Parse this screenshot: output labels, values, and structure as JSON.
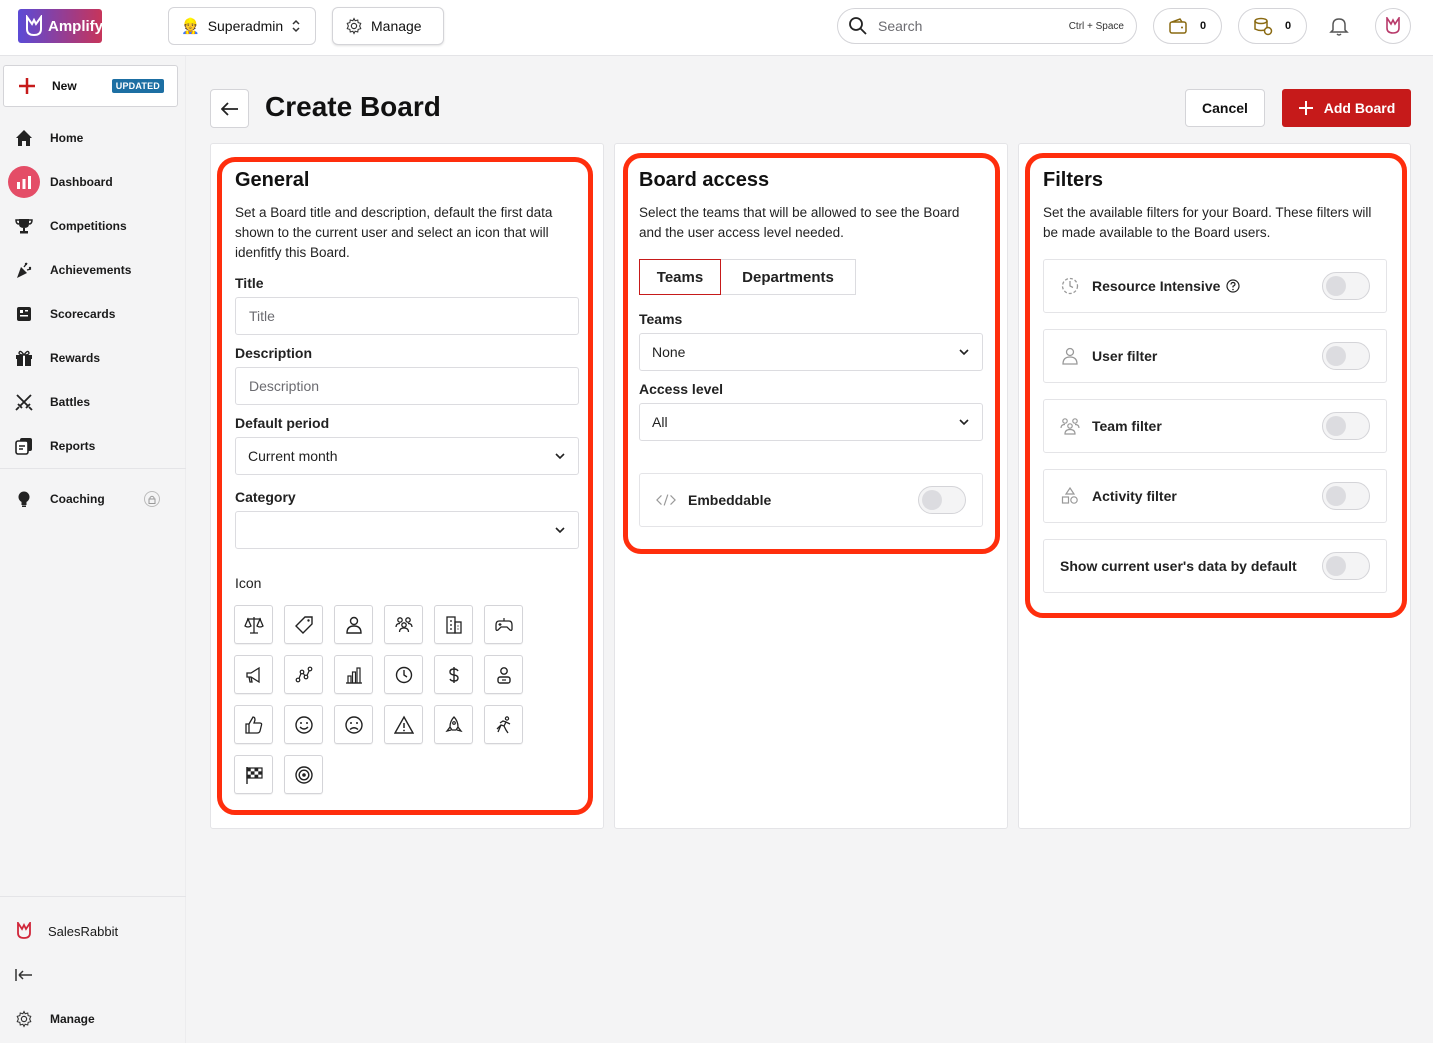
{
  "app": {
    "logo_text": "Amplify"
  },
  "topbar": {
    "role_label": "Superadmin",
    "manage_label": "Manage",
    "search_placeholder": "Search",
    "search_shortcut": "Ctrl + Space",
    "wallet_count": "0",
    "coins_count": "0"
  },
  "sidebar": {
    "new_label": "New",
    "new_badge": "UPDATED",
    "items": [
      {
        "label": "Home",
        "icon": "home-icon"
      },
      {
        "label": "Dashboard",
        "icon": "chart-icon",
        "active": true
      },
      {
        "label": "Competitions",
        "icon": "trophy-icon"
      },
      {
        "label": "Achievements",
        "icon": "party-icon"
      },
      {
        "label": "Scorecards",
        "icon": "scorecard-icon"
      },
      {
        "label": "Rewards",
        "icon": "gift-icon"
      },
      {
        "label": "Battles",
        "icon": "swords-icon"
      },
      {
        "label": "Reports",
        "icon": "reports-icon"
      }
    ],
    "coaching_label": "Coaching",
    "org_label": "SalesRabbit",
    "manage_label": "Manage"
  },
  "header": {
    "title": "Create Board",
    "cancel_label": "Cancel",
    "add_label": "Add Board"
  },
  "general": {
    "title": "General",
    "description": "Set a Board title and description, default the first data shown to the current user and select an icon that will idenfitfy this Board.",
    "title_label": "Title",
    "title_placeholder": "Title",
    "description_label": "Description",
    "description_placeholder": "Description",
    "period_label": "Default period",
    "period_value": "Current month",
    "category_label": "Category",
    "category_value": "",
    "icon_label": "Icon",
    "icons": [
      "scale-icon",
      "tag-icon",
      "user-icon",
      "team-icon",
      "building-icon",
      "gamepad-icon",
      "megaphone-icon",
      "graph-icon",
      "bar-chart-icon",
      "clock-icon",
      "dollar-icon",
      "person-icon",
      "thumbs-up-icon",
      "smile-icon",
      "frown-icon",
      "warning-icon",
      "rocket-icon",
      "runner-icon",
      "checkered-flag-icon",
      "target-icon"
    ]
  },
  "board_access": {
    "title": "Board access",
    "description": "Select the teams that will be allowed to see the Board and the user access level needed.",
    "tab_teams": "Teams",
    "tab_departments": "Departments",
    "teams_label": "Teams",
    "teams_value": "None",
    "access_label": "Access level",
    "access_value": "All",
    "embeddable_label": "Embeddable"
  },
  "filters": {
    "title": "Filters",
    "description": "Set the available filters for your Board. These filters will be made available to the Board users.",
    "items": [
      {
        "label": "Resource Intensive"
      },
      {
        "label": "User filter"
      },
      {
        "label": "Team filter"
      },
      {
        "label": "Activity filter"
      },
      {
        "label": "Show current user's data by default"
      }
    ]
  },
  "colors": {
    "accent": "#c61a1a",
    "highlight": "#ff2e0d",
    "badge": "#1d6fa3",
    "dashboard_active": "#e44d67"
  }
}
